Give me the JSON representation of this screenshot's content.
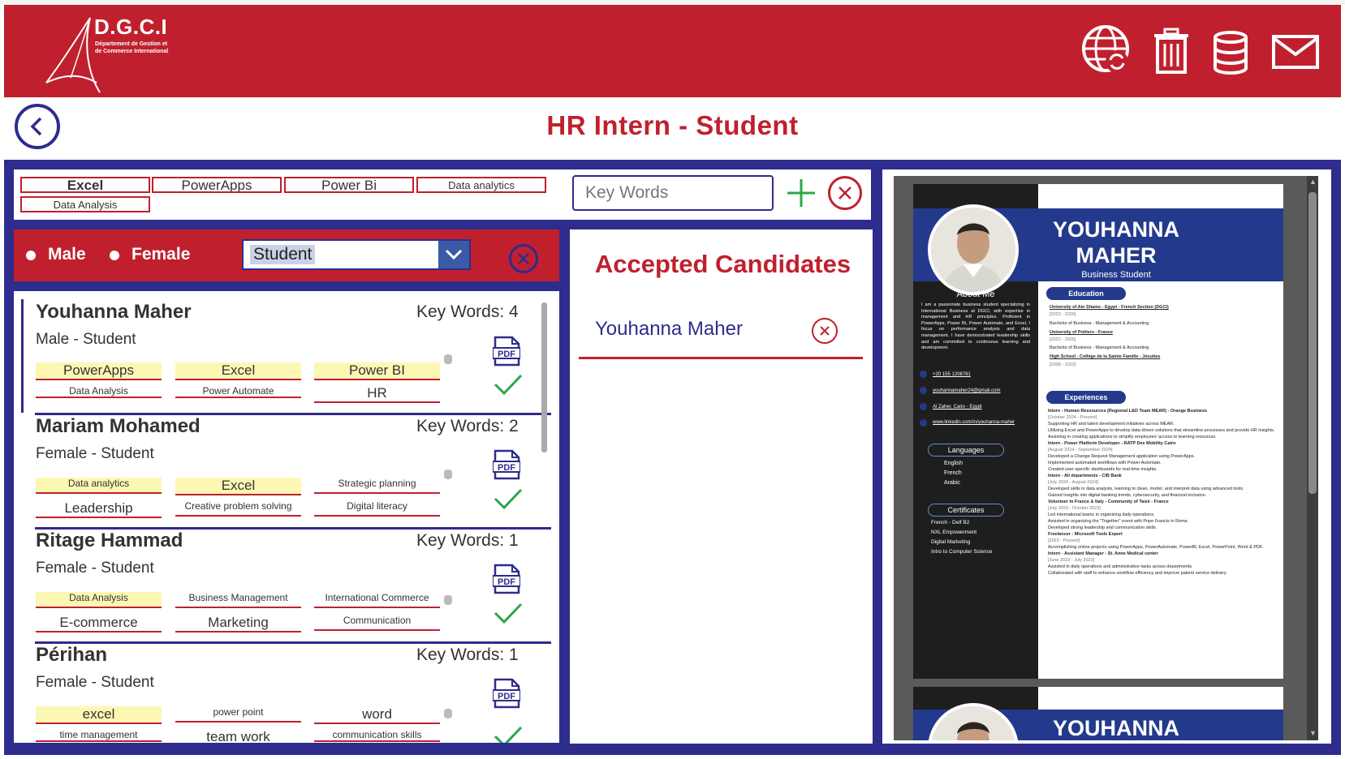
{
  "header": {
    "logo_text": "D.G.C.I",
    "logo_sub1": "Département de Gestion et",
    "logo_sub2": "de Commerce International",
    "icons": [
      "globe-refresh-icon",
      "trash-icon",
      "database-icon",
      "mail-icon"
    ]
  },
  "page": {
    "title": "HR Intern -  Student"
  },
  "filters": {
    "tags_row1": [
      "Excel",
      "PowerApps",
      "Power Bi",
      "Data analytics"
    ],
    "tags_row2": [
      "Data Analysis"
    ],
    "keywords_placeholder": "Key Words",
    "gender_options": [
      "Male",
      "Female"
    ],
    "status_selected": "Student"
  },
  "candidates": [
    {
      "name": "Youhanna Maher",
      "sub": "Male - Student",
      "keywords": "Key Words: 4",
      "skills_row1": [
        "PowerApps",
        "Excel",
        "Power BI"
      ],
      "skills_row2": [
        "Data Analysis",
        "Power Automate",
        "HR"
      ]
    },
    {
      "name": "Mariam Mohamed",
      "sub": "Female - Student",
      "keywords": "Key Words: 2",
      "skills_row1": [
        "Data analytics",
        "Excel",
        "Strategic planning"
      ],
      "skills_row2": [
        "Leadership",
        "Creative problem solving",
        "Digital literacy"
      ]
    },
    {
      "name": "Ritage Hammad",
      "sub": "Female - Student",
      "keywords": "Key Words: 1",
      "skills_row1": [
        "Data Analysis",
        "Business Management",
        "International Commerce"
      ],
      "skills_row2": [
        "E-commerce",
        "Marketing",
        "Communication"
      ]
    },
    {
      "name": "Périhan",
      "sub": "Female - Student",
      "keywords": "Key Words: 1",
      "skills_row1": [
        "excel",
        "power point",
        "word"
      ],
      "skills_row2": [
        "time management",
        "team work",
        "communication skills"
      ]
    }
  ],
  "accepted": {
    "title": "Accepted Candidates",
    "names": [
      "Youhanna Maher"
    ]
  },
  "resume": {
    "first_name": "YOUHANNA",
    "last_name": "MAHER",
    "subtitle": "Business Student",
    "about_title": "About Me",
    "about_text": "I am a passionate business student specializing in International Business at DGCI, with expertise in management and HR principles. Proficient in PowerApps, Power BI, Power Automate, and Excel, I focus on performance analysis and data management. I have demonstrated leadership skills and am committed to continuous learning and development.",
    "phone": "+20 155 1208781",
    "email": "youhannamaher24@gmail.com",
    "location": "Al Zaher, Cairo - Egypt",
    "linkedin": "www.linkedin.com/in/youhanna-maher",
    "languages_title": "Languages",
    "languages": [
      "English",
      "French",
      "Arabic"
    ],
    "certificates_title": "Certificates",
    "certificates": [
      "French - Delf B2",
      "NXL Empowerment",
      "Digital Marketing",
      "Intro to Computer Science"
    ],
    "education_title": "Education",
    "education": [
      "University of Ain Shams - Egypt - French Section (DGCI)",
      "[2022 - 2026]",
      "Bachelor of Business - Management & Accounting",
      "University of Poitiers - France",
      "[2022 - 2025]",
      "Bachelor of Business - Management & Accounting",
      "High School - Collège de la Sainte Famille - Jésuites",
      "[2008 - 2022]"
    ],
    "experiences_title": "Experiences",
    "experiences": [
      "Intern - Human Ressources (Regional L&D Team MEAR) - Orange Business",
      "[October 2024 - Present]",
      "Supporting HR and talent development initiatives across MEAR.",
      "Utilizing Excel and PowerApps to develop data-driven solutions that streamline processes and provide HR insights.",
      "Assisting in creating applications to simplify employees' access to learning resources.",
      "Intern - Power Platform Developer - RATP Dev Mobility Cairo",
      "[August 2024 - September 2024]",
      "Developed a Change Request Management application using PowerApps.",
      "Implemented automated workflows with Power Automate.",
      "Created user-specific dashboards for real-time insights.",
      "Intern - All departments - CIB Bank",
      "[July 2024 - August 2024]",
      "Developed skills in data analysis, learning to clean, model, and interpret data using advanced tools.",
      "Gained insights into digital banking trends, cybersecurity, and financial inclusion.",
      "Volunteer in France & Italy - Community of Taizé - France",
      "[July 2023 - October 2023]",
      "Led international teams in organizing daily operations.",
      "Assisted in organizing the \"Together\" event with Pope Francis in Rome.",
      "Developed strong leadership and communication skills.",
      "Freelancer - Microsoft Tools Expert",
      "[2023 - Present]",
      "Accomplishing online projects using PowerApps, PowerAutomate, PowerBI, Excel, PowerPoint, Word & PDF.",
      "Intern - Assistant Manager - St. Anne Medical center",
      "[June 2023 - July 2023]",
      "Assisted in daily operations and administrative tasks across departments.",
      "Collaborated with staff to enhance workflow efficiency and improve patient service delivery."
    ]
  }
}
